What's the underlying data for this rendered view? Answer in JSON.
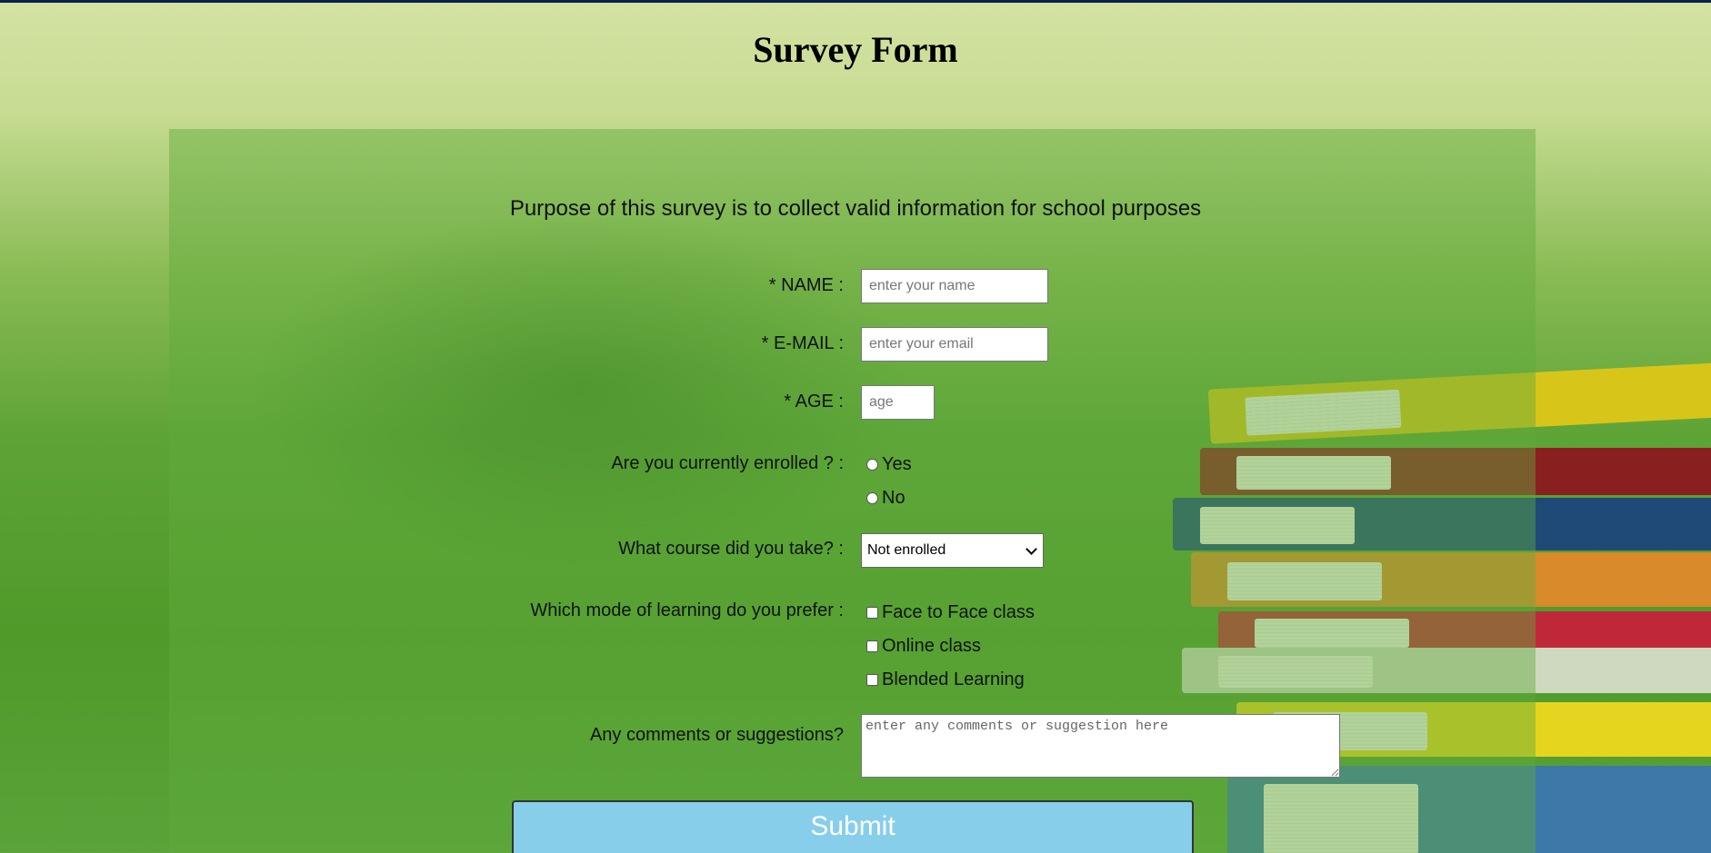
{
  "page": {
    "title": "Survey Form",
    "purpose": "Purpose of this survey is to collect valid information for school purposes"
  },
  "form": {
    "name": {
      "label": "* NAME :",
      "placeholder": "enter your name"
    },
    "email": {
      "label": "* E-MAIL :",
      "placeholder": "enter your email"
    },
    "age": {
      "label": "* AGE :",
      "placeholder": "age"
    },
    "enrolled": {
      "label": "Are you currently enrolled ? :",
      "options": [
        "Yes",
        "No"
      ]
    },
    "course": {
      "label": "What course did you take? :",
      "selected": "Not enrolled"
    },
    "mode": {
      "label": "Which mode of learning do you prefer :",
      "options": [
        "Face to Face class",
        "Online class",
        "Blended Learning"
      ]
    },
    "comments": {
      "label": "Any comments or suggestions?",
      "placeholder": "enter any comments or suggestion here"
    },
    "submit_label": "Submit"
  },
  "colors": {
    "panel": "#5faa3c",
    "submit_bg": "#87ceeb",
    "top_border": "#0a1f4f"
  }
}
